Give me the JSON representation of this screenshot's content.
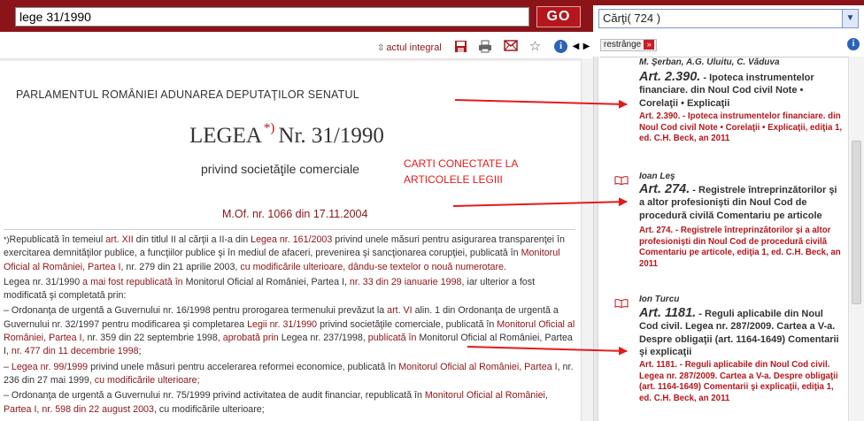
{
  "search": {
    "query": "lege 31/1990",
    "go_label": "GO"
  },
  "right_header": {
    "books_select": "Cărţi( 724 )"
  },
  "toolbar": {
    "actul_integral": "actul integral"
  },
  "document": {
    "header": "PARLAMENTUL ROMÂNIEI ADUNAREA DEPUTAŢILOR SENATUL",
    "title_main": "LEGEA",
    "title_note": "*)",
    "title_number": "Nr. 31/1990",
    "subtitle": "privind societăţile comerciale",
    "mof": "M.Of. nr. 1066 din 17.11.2004",
    "annotation": "CARTI CONECTATE LA ARTICOLELE LEGIII",
    "paragraphs": [
      {
        "star": "*)",
        "parts": [
          "Republicată în temeiul ",
          "art. XII",
          " din titlul II al cărţii a II-a din ",
          "Legea nr. 161/2003",
          " privind unele măsuri pentru asigurarea transparenţei în exercitarea demnităţilor publice, a funcţiilor publice şi în mediul de afaceri, prevenirea şi sancţionarea corupţiei, publicată în ",
          "Monitorul Oficial al României, Partea I",
          ", nr. 279 din 21 aprilie 2003",
          ", cu modificările ulterioare, dându-se textelor o nouă numerotare."
        ]
      },
      {
        "parts": [
          "Legea nr. 31/1990",
          " a mai fost republicată în ",
          "Monitorul Oficial al României, Partea I",
          ", nr. 33 din 29 ianuarie 1998",
          ", iar ulterior a fost modificată şi completată prin:"
        ]
      },
      {
        "parts": [
          "– Ordonanţa de urgentă a Guvernului nr. 16/1998 pentru prorogarea termenului prevăzut la ",
          "art. VI",
          " alin. 1 din Ordonanţa de urgentă a Guvernului nr. 32/1997 pentru modificarea şi completarea ",
          "Legii nr. 31/1990",
          " privind societăţile comerciale, publicată în ",
          "Monitorul Oficial al României, Partea I",
          ", nr. 359 din 22 septembrie 1998",
          ", aprobată prin ",
          "Legea nr. 237/1998",
          ", publicată în ",
          "Monitorul Oficial al României, Partea I",
          ", nr. 477 din 11 decembrie 1998",
          ";"
        ]
      },
      {
        "parts": [
          "– ",
          "Legea nr. 99/1999",
          " privind unele măsuri pentru accelerarea reformei economice, publicată în ",
          "Monitorul Oficial al României, Partea I",
          ", nr. 236 din 27 mai 1999",
          ", cu modificările ulterioare;"
        ]
      },
      {
        "parts": [
          "– Ordonanţa de urgentă a Guvernului nr. 75/1999 privind activitatea de audit financiar, republicată în ",
          "Monitorul Oficial al României",
          ", ",
          "Partea I, nr. 598 din 22 august 2003",
          ", cu modificările ulterioare;"
        ]
      }
    ]
  },
  "panel": {
    "collapse_label": "restrânge",
    "partial_author": "M. Şerban, A.G. Uluitu, C. Văduva",
    "books": [
      {
        "author": "",
        "art": "Art. 2.390.",
        "title": " - Ipoteca instrumentelor financiare. din Noul Cod civil Note • Corelaţii • Explicaţii",
        "desc": "Art. 2.390. - Ipoteca instrumentelor financiare. din Noul Cod civil Note • Corelaţii • Explicaţii, ediţia 1, ed. C.H. Beck, an 2011"
      },
      {
        "author": "Ioan Leş",
        "art": "Art. 274.",
        "title": " - Registrele întreprinzătorilor şi a altor profesionişti din Noul Cod de procedură civilă Comentariu pe articole",
        "desc": "Art. 274. - Registrele întreprinzătorilor şi a altor profesionişti din Noul Cod de procedură civilă Comentariu pe articole, ediţia 1, ed. C.H. Beck, an 2011"
      },
      {
        "author": "Ion Turcu",
        "art": "Art. 1181.",
        "title": " - Reguli aplicabile din Noul Cod civil. Legea nr. 287/2009. Cartea a V-a. Despre obligaţii (art. 1164-1649) Comentarii şi explicaţii",
        "desc": "Art. 1181. - Reguli aplicabile din Noul Cod civil. Legea nr. 287/2009. Cartea a V-a. Despre obligaţii (art. 1164-1649) Comentarii şi explicaţii, ediţia 1, ed. C.H. Beck, an 2011"
      }
    ]
  },
  "colors": {
    "brand": "#8b1418",
    "link": "#8b1418",
    "annotation": "#e31b1b",
    "arrow": "#e31b1b"
  }
}
